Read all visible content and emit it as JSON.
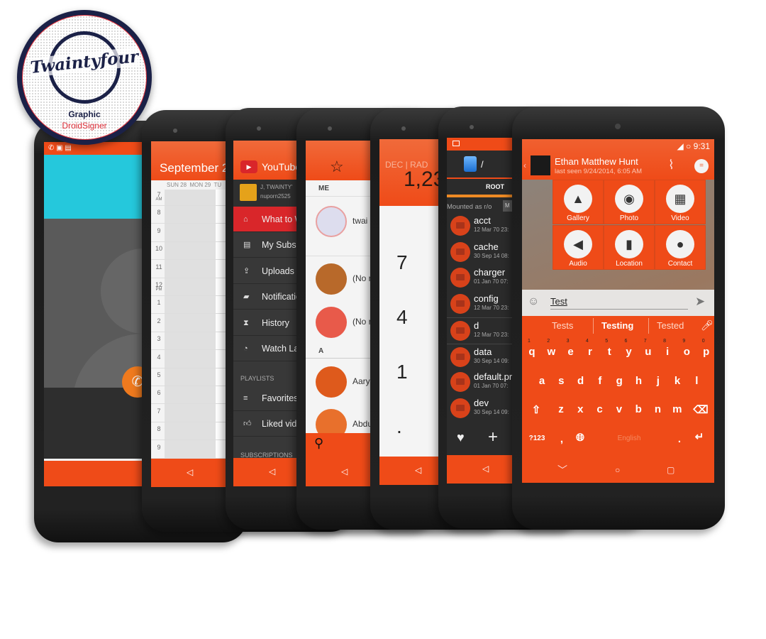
{
  "logo": {
    "brand": "Twaintyfour",
    "line1": "Graphic",
    "line2": "DroidSigner"
  },
  "colors": {
    "accent": "#ef4b18",
    "dark": "#2b2b2b",
    "logo_navy": "#1b2147",
    "logo_red": "#e0303a"
  },
  "calendar": {
    "title": "September 2",
    "days": "SUN 28  MON 29  TU",
    "hours": [
      "7",
      "8",
      "9",
      "10",
      "11",
      "12",
      "1",
      "2",
      "3",
      "4",
      "5",
      "6",
      "7",
      "8",
      "9"
    ],
    "am": "AM",
    "pm": "PM"
  },
  "youtube": {
    "title": "YouTube",
    "account_name": "J, TWAINTY'",
    "account_email": "nuporn2525",
    "items": [
      {
        "label": "What to Watch",
        "icon": "home-icon"
      },
      {
        "label": "My Subscriptions",
        "icon": "subscriptions-icon"
      },
      {
        "label": "Uploads",
        "icon": "upload-icon"
      },
      {
        "label": "Notifications",
        "icon": "notifications-icon"
      },
      {
        "label": "History",
        "icon": "hourglass-icon"
      },
      {
        "label": "Watch Later",
        "icon": "clock-icon"
      }
    ],
    "playlists_label": "PLAYLISTS",
    "playlists": [
      {
        "label": "Favorites",
        "icon": "list-icon"
      },
      {
        "label": "Liked videos",
        "icon": "thumbs-up-icon"
      }
    ],
    "subscriptions_label": "SUBSCRIPTIONS"
  },
  "contacts": {
    "me_label": "ME",
    "me_name": "twai",
    "section_a": "A",
    "rows": [
      {
        "name": "(No name)",
        "color": "#b8692a"
      },
      {
        "name": "(No name)",
        "color": "#e85a4a"
      }
    ],
    "a_rows": [
      {
        "name": "Aary",
        "color": "#de5a1c"
      },
      {
        "name": "Abdu",
        "color": "#e8702c"
      }
    ]
  },
  "calculator": {
    "mode": "DEC | RAD",
    "display": "1,23",
    "digits": [
      "7",
      "4",
      "1",
      "."
    ]
  },
  "files": {
    "path": "/",
    "tab": "ROOT",
    "mounted": "Mounted as r/o",
    "mount_btn": "M",
    "items": [
      {
        "name": "acct",
        "date": "12 Mar 70 23:"
      },
      {
        "name": "cache",
        "date": "30 Sep 14 08:"
      },
      {
        "name": "charger",
        "date": "01 Jan 70 07:"
      },
      {
        "name": "config",
        "date": "12 Mar 70 23:"
      },
      {
        "name": "d",
        "date": "12 Mar 70 23:"
      },
      {
        "name": "data",
        "date": "30 Sep 14 09:"
      },
      {
        "name": "default.pr",
        "date": "01 Jan 70 07:"
      },
      {
        "name": "dev",
        "date": "30 Sep 14 09:"
      }
    ]
  },
  "chat": {
    "time": "9:31",
    "contact": "Ethan Matthew Hunt",
    "last_seen": "last seen 9/24/2014, 6:05 AM",
    "attachments": [
      {
        "label": "Gallery",
        "icon": "▲"
      },
      {
        "label": "Photo",
        "icon": "◉"
      },
      {
        "label": "Video",
        "icon": "▦"
      },
      {
        "label": "Audio",
        "icon": "◀"
      },
      {
        "label": "Location",
        "icon": "▮"
      },
      {
        "label": "Contact",
        "icon": "●"
      }
    ],
    "input_value": "Test",
    "suggestions": [
      "Tests",
      "Testing",
      "Tested"
    ],
    "row1": [
      "q",
      "w",
      "e",
      "r",
      "t",
      "y",
      "u",
      "i",
      "o",
      "p"
    ],
    "row1_nums": [
      "1",
      "2",
      "3",
      "4",
      "5",
      "6",
      "7",
      "8",
      "9",
      "0"
    ],
    "row2": [
      "a",
      "s",
      "d",
      "f",
      "g",
      "h",
      "j",
      "k",
      "l"
    ],
    "row3": [
      "z",
      "x",
      "c",
      "v",
      "b",
      "n",
      "m"
    ],
    "symbols_key": "?123",
    "comma": ",",
    "space_label": "English",
    "period": "."
  }
}
